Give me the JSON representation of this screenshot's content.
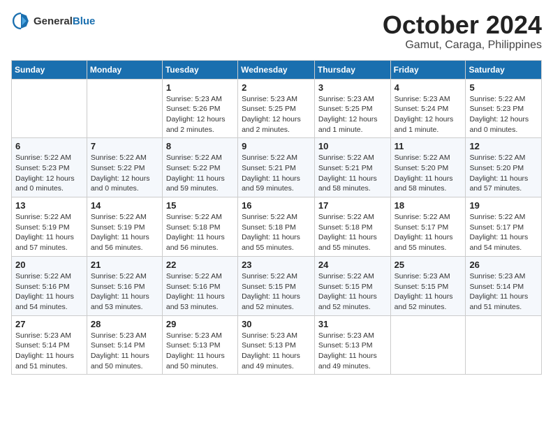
{
  "header": {
    "logo_general": "General",
    "logo_blue": "Blue",
    "month": "October 2024",
    "location": "Gamut, Caraga, Philippines"
  },
  "columns": [
    "Sunday",
    "Monday",
    "Tuesday",
    "Wednesday",
    "Thursday",
    "Friday",
    "Saturday"
  ],
  "weeks": [
    [
      {
        "day": "",
        "info": ""
      },
      {
        "day": "",
        "info": ""
      },
      {
        "day": "1",
        "info": "Sunrise: 5:23 AM\nSunset: 5:26 PM\nDaylight: 12 hours\nand 2 minutes."
      },
      {
        "day": "2",
        "info": "Sunrise: 5:23 AM\nSunset: 5:25 PM\nDaylight: 12 hours\nand 2 minutes."
      },
      {
        "day": "3",
        "info": "Sunrise: 5:23 AM\nSunset: 5:25 PM\nDaylight: 12 hours\nand 1 minute."
      },
      {
        "day": "4",
        "info": "Sunrise: 5:23 AM\nSunset: 5:24 PM\nDaylight: 12 hours\nand 1 minute."
      },
      {
        "day": "5",
        "info": "Sunrise: 5:22 AM\nSunset: 5:23 PM\nDaylight: 12 hours\nand 0 minutes."
      }
    ],
    [
      {
        "day": "6",
        "info": "Sunrise: 5:22 AM\nSunset: 5:23 PM\nDaylight: 12 hours\nand 0 minutes."
      },
      {
        "day": "7",
        "info": "Sunrise: 5:22 AM\nSunset: 5:22 PM\nDaylight: 12 hours\nand 0 minutes."
      },
      {
        "day": "8",
        "info": "Sunrise: 5:22 AM\nSunset: 5:22 PM\nDaylight: 11 hours\nand 59 minutes."
      },
      {
        "day": "9",
        "info": "Sunrise: 5:22 AM\nSunset: 5:21 PM\nDaylight: 11 hours\nand 59 minutes."
      },
      {
        "day": "10",
        "info": "Sunrise: 5:22 AM\nSunset: 5:21 PM\nDaylight: 11 hours\nand 58 minutes."
      },
      {
        "day": "11",
        "info": "Sunrise: 5:22 AM\nSunset: 5:20 PM\nDaylight: 11 hours\nand 58 minutes."
      },
      {
        "day": "12",
        "info": "Sunrise: 5:22 AM\nSunset: 5:20 PM\nDaylight: 11 hours\nand 57 minutes."
      }
    ],
    [
      {
        "day": "13",
        "info": "Sunrise: 5:22 AM\nSunset: 5:19 PM\nDaylight: 11 hours\nand 57 minutes."
      },
      {
        "day": "14",
        "info": "Sunrise: 5:22 AM\nSunset: 5:19 PM\nDaylight: 11 hours\nand 56 minutes."
      },
      {
        "day": "15",
        "info": "Sunrise: 5:22 AM\nSunset: 5:18 PM\nDaylight: 11 hours\nand 56 minutes."
      },
      {
        "day": "16",
        "info": "Sunrise: 5:22 AM\nSunset: 5:18 PM\nDaylight: 11 hours\nand 55 minutes."
      },
      {
        "day": "17",
        "info": "Sunrise: 5:22 AM\nSunset: 5:18 PM\nDaylight: 11 hours\nand 55 minutes."
      },
      {
        "day": "18",
        "info": "Sunrise: 5:22 AM\nSunset: 5:17 PM\nDaylight: 11 hours\nand 55 minutes."
      },
      {
        "day": "19",
        "info": "Sunrise: 5:22 AM\nSunset: 5:17 PM\nDaylight: 11 hours\nand 54 minutes."
      }
    ],
    [
      {
        "day": "20",
        "info": "Sunrise: 5:22 AM\nSunset: 5:16 PM\nDaylight: 11 hours\nand 54 minutes."
      },
      {
        "day": "21",
        "info": "Sunrise: 5:22 AM\nSunset: 5:16 PM\nDaylight: 11 hours\nand 53 minutes."
      },
      {
        "day": "22",
        "info": "Sunrise: 5:22 AM\nSunset: 5:16 PM\nDaylight: 11 hours\nand 53 minutes."
      },
      {
        "day": "23",
        "info": "Sunrise: 5:22 AM\nSunset: 5:15 PM\nDaylight: 11 hours\nand 52 minutes."
      },
      {
        "day": "24",
        "info": "Sunrise: 5:22 AM\nSunset: 5:15 PM\nDaylight: 11 hours\nand 52 minutes."
      },
      {
        "day": "25",
        "info": "Sunrise: 5:23 AM\nSunset: 5:15 PM\nDaylight: 11 hours\nand 52 minutes."
      },
      {
        "day": "26",
        "info": "Sunrise: 5:23 AM\nSunset: 5:14 PM\nDaylight: 11 hours\nand 51 minutes."
      }
    ],
    [
      {
        "day": "27",
        "info": "Sunrise: 5:23 AM\nSunset: 5:14 PM\nDaylight: 11 hours\nand 51 minutes."
      },
      {
        "day": "28",
        "info": "Sunrise: 5:23 AM\nSunset: 5:14 PM\nDaylight: 11 hours\nand 50 minutes."
      },
      {
        "day": "29",
        "info": "Sunrise: 5:23 AM\nSunset: 5:13 PM\nDaylight: 11 hours\nand 50 minutes."
      },
      {
        "day": "30",
        "info": "Sunrise: 5:23 AM\nSunset: 5:13 PM\nDaylight: 11 hours\nand 49 minutes."
      },
      {
        "day": "31",
        "info": "Sunrise: 5:23 AM\nSunset: 5:13 PM\nDaylight: 11 hours\nand 49 minutes."
      },
      {
        "day": "",
        "info": ""
      },
      {
        "day": "",
        "info": ""
      }
    ]
  ]
}
